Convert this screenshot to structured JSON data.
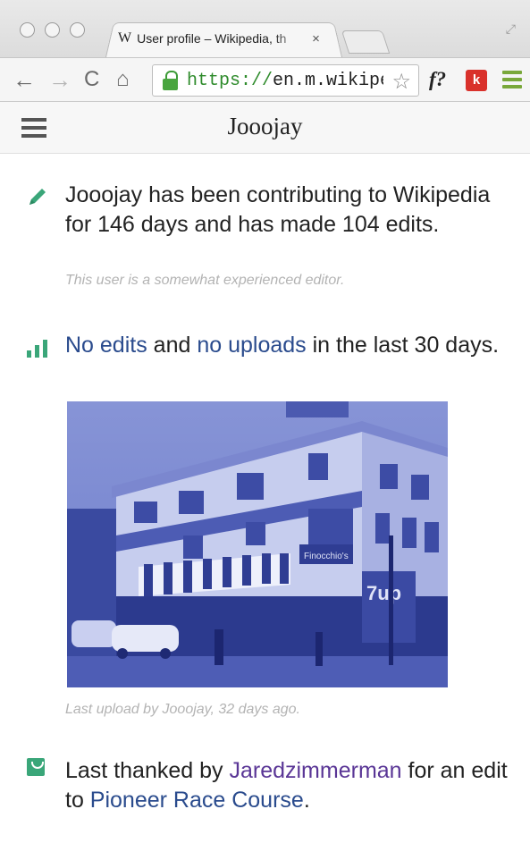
{
  "browser": {
    "tab": {
      "favicon": "W",
      "title": "User profile – Wikipedia, th",
      "close_glyph": "×"
    },
    "nav": {
      "back_glyph": "←",
      "forward_glyph": "→",
      "reload_glyph": "C",
      "home_glyph": "⌂"
    },
    "url": {
      "scheme": "https://",
      "rest": "en.m.wikipedi..."
    },
    "extensions": {
      "f_label": "f?",
      "k_label": "k"
    }
  },
  "page": {
    "header_title": "Jooojay",
    "contributions": {
      "text": "Jooojay has been contributing to Wikipedia for 146 days and has made 104 edits.",
      "experience": "This user is a somewhat experienced editor."
    },
    "activity": {
      "edits_link": "No edits",
      "and": " and ",
      "uploads_link": "no uploads",
      "rest": " in the last 30 days."
    },
    "upload": {
      "caption": "Last upload by Jooojay, 32 days ago."
    },
    "thanks": {
      "prefix": "Last thanked by ",
      "user_link": "Jaredzimmerman",
      "middle": " for an edit to ",
      "article_link": "Pioneer Race Course",
      "suffix": "."
    }
  },
  "colors": {
    "accent_green": "#3aa679",
    "link_blue": "#2a4b8d",
    "link_visited": "#5a3696",
    "photo_tint": "#5a6fc4"
  }
}
